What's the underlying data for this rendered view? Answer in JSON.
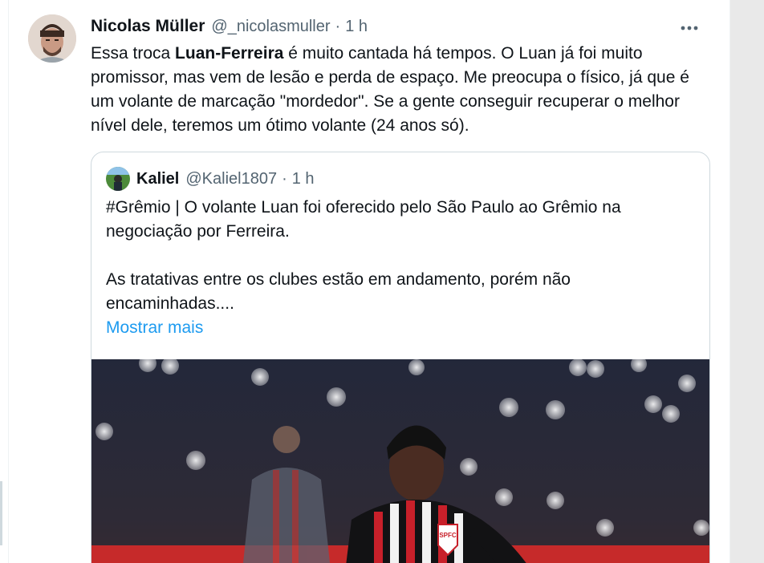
{
  "tweet": {
    "author_name": "Nicolas Müller",
    "author_handle": "@_nicolasmuller",
    "separator": "·",
    "time": "1 h",
    "more_label": "•••",
    "text_before": "Essa troca ",
    "text_bold": "Luan-Ferreira",
    "text_after": " é muito cantada há tempos. O Luan já foi muito promissor, mas vem de lesão e perda de espaço. Me preocupa o físico, já que é um volante de marcação \"mordedor\". Se a gente conseguir recuperar o melhor nível dele, teremos um ótimo volante (24 anos só)."
  },
  "quoted": {
    "author_name": "Kaliel",
    "author_handle": "@Kaliel1807",
    "separator": "·",
    "time": "1 h",
    "line1": "#Grêmio | O volante Luan foi oferecido pelo São Paulo ao Grêmio na negociação por Ferreira.",
    "line2": "As tratativas entre os clubes estão em andamento, porém não encaminhadas....",
    "show_more": "Mostrar mais",
    "badge_text": "SPFC"
  },
  "colors": {
    "text": "#0f1419",
    "secondary": "#536471",
    "link": "#1d9bf0",
    "border": "#cfd9de"
  }
}
